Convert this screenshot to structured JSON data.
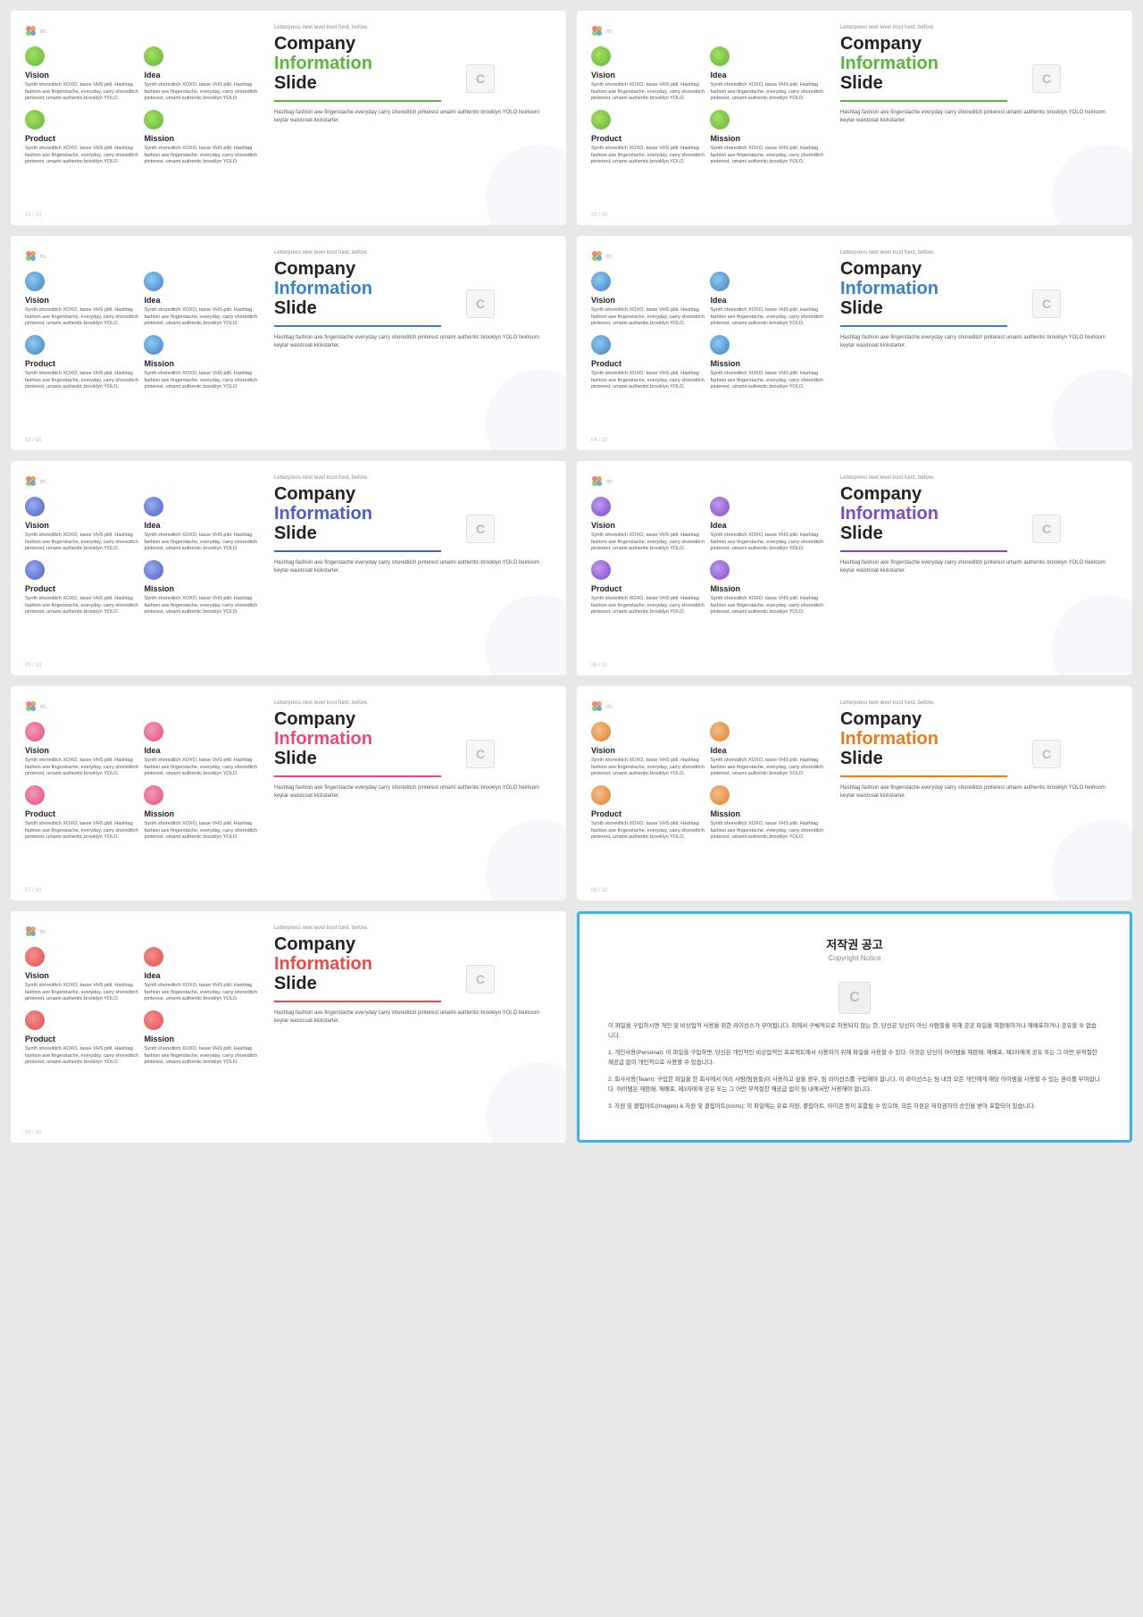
{
  "slides": [
    {
      "id": 1,
      "color_class": "color-green",
      "div_class": "div-green",
      "dot_vision": "dot-green",
      "dot_idea": "dot-green",
      "dot_product": "dot-green",
      "dot_mission": "dot-green",
      "header_text": "Letterpress next level trust fund, before.",
      "company": "Company",
      "information": "Information",
      "slide_text": "Slide",
      "divider_color": "#5ab53c",
      "body_text": "Hashtag fashion axe fingerstache everyday carry shoreditch pinterest umami authentic brooklyn YOLO heirloom keytar waistcoat kickstarter.",
      "page": "01 / 10",
      "badge": "C"
    },
    {
      "id": 2,
      "color_class": "color-green",
      "div_class": "div-green",
      "dot_vision": "dot-green",
      "dot_idea": "dot-green",
      "dot_product": "dot-green",
      "dot_mission": "dot-green",
      "header_text": "Letterpress next level trust fund, before.",
      "company": "Company",
      "information": "Information",
      "slide_text": "Slide",
      "divider_color": "#5ab53c",
      "body_text": "Hashtag fashion axe fingerstache everyday carry shoreditch pinterest umami authentic brooklyn YOLO heirloom keytar waistcoat kickstarter.",
      "page": "02 / 10",
      "badge": "C"
    },
    {
      "id": 3,
      "color_class": "color-blue",
      "div_class": "div-blue",
      "dot_vision": "dot-blue",
      "dot_idea": "dot-blue",
      "dot_product": "dot-blue",
      "dot_mission": "dot-blue",
      "header_text": "Letterpress next level trust fund, before.",
      "company": "Company",
      "information": "Information",
      "slide_text": "Slide",
      "divider_color": "#3b82c4",
      "body_text": "Hashtag fashion axe fingerstache everyday carry shoreditch pinterest umami authentic brooklyn YOLO heirloom keytar waistcoat kickstarter.",
      "page": "03 / 10",
      "badge": "C"
    },
    {
      "id": 4,
      "color_class": "color-blue",
      "div_class": "div-blue",
      "dot_vision": "dot-blue",
      "dot_idea": "dot-blue",
      "dot_product": "dot-blue",
      "dot_mission": "dot-blue",
      "header_text": "Letterpress next level trust fund, before.",
      "company": "Company",
      "information": "Information",
      "slide_text": "Slide",
      "divider_color": "#3b82c4",
      "body_text": "Hashtag fashion axe fingerstache everyday carry shoreditch pinterest umami authentic brooklyn YOLO heirloom keytar waistcoat kickstarter.",
      "page": "04 / 10",
      "badge": "C"
    },
    {
      "id": 5,
      "color_class": "color-indigo",
      "div_class": "div-indigo",
      "dot_vision": "dot-indigo",
      "dot_idea": "dot-indigo",
      "dot_product": "dot-indigo",
      "dot_mission": "dot-indigo",
      "header_text": "Letterpress next level trust fund, before.",
      "company": "Company",
      "information": "Information",
      "slide_text": "Slide",
      "divider_color": "#4a5fc4",
      "body_text": "Hashtag fashion axe fingerstache everyday carry shoreditch pinterest umami authentic brooklyn YOLO heirloom keytar waistcoat kickstarter.",
      "page": "05 / 10",
      "badge": "C"
    },
    {
      "id": 6,
      "color_class": "color-purple",
      "div_class": "div-purple",
      "dot_vision": "dot-purple",
      "dot_idea": "dot-purple",
      "dot_product": "dot-purple",
      "dot_mission": "dot-purple",
      "header_text": "Letterpress next level trust fund, before.",
      "company": "Company",
      "information": "Information",
      "slide_text": "Slide",
      "divider_color": "#7c4ac4",
      "body_text": "Hashtag fashion axe fingerstache everyday carry shoreditch pinterest umami authentic brooklyn YOLO heirloom keytar waistcoat kickstarter.",
      "page": "06 / 10",
      "badge": "C"
    },
    {
      "id": 7,
      "color_class": "color-pink",
      "div_class": "div-pink",
      "dot_vision": "dot-pink",
      "dot_idea": "dot-pink",
      "dot_product": "dot-pink",
      "dot_mission": "dot-pink",
      "header_text": "Letterpress next level trust fund, before.",
      "company": "Company",
      "information": "Information",
      "slide_text": "Slide",
      "divider_color": "#e94a7a",
      "body_text": "Hashtag fashion axe fingerstache everyday carry shoreditch pinterest umami authentic brooklyn YOLO heirloom keytar waistcoat kickstarter.",
      "page": "07 / 10",
      "badge": "C"
    },
    {
      "id": 8,
      "color_class": "color-orange",
      "div_class": "div-orange",
      "dot_vision": "dot-orange",
      "dot_idea": "dot-orange",
      "dot_product": "dot-orange",
      "dot_mission": "dot-orange",
      "header_text": "Letterpress next level trust fund, before.",
      "company": "Company",
      "information": "Information",
      "slide_text": "Slide",
      "divider_color": "#e87c1e",
      "body_text": "Hashtag fashion axe fingerstache everyday carry shoreditch pinterest umami authentic brooklyn YOLO heirloom keytar waistcoat kickstarter.",
      "page": "08 / 10",
      "badge": "C"
    },
    {
      "id": 9,
      "color_class": "color-red",
      "div_class": "div-red",
      "dot_vision": "dot-red",
      "dot_idea": "dot-red",
      "dot_product": "dot-red",
      "dot_mission": "dot-red",
      "header_text": "Letterpress next level trust fund, before.",
      "company": "Company",
      "information": "Information",
      "slide_text": "Slide",
      "divider_color": "#e84a4a",
      "body_text": "Hashtag fashion axe fingerstache everyday carry shoreditch pinterest umami authentic brooklyn YOLO heirloom keytar waistcoat kickstarter.",
      "page": "09 / 10",
      "badge": "C"
    }
  ],
  "sections": {
    "vision": "Vision",
    "idea": "Idea",
    "product": "Product",
    "mission": "Mission",
    "body_short": "Synth shoreditch XOXO, tasse VHS pitil. Hashtag fashion axe fingerstache, everyday, carry shoreditch pinterest, umami authentic.brooklyn YOLO.",
    "body_long": "Synth shoreditch XOXO, tasse VHS pitil. Hashtag fashion axe fingerstache, everyday, carry shoreditch pinterest, umami authentic.brooklyn YOLO."
  },
  "copyright": {
    "title": "저작권 공고",
    "subtitle": "Copyright Notice",
    "badge": "C",
    "paragraphs": [
      "이 파일을 구입하시면 개인 및 비상업적 사용을 위한 라이선스가 부여됩니다. 위에서 구체적으로 허용되지 않는 한, 당신은 당신이 아닌 사람들을 위해 공공 파일을 재판매하거나 재배포하거나 공유할 수 없습니다.",
      "1. 개인사용(Personal): 이 파일을 구입하면, 당신은 개인적인 비상업적인 프로젝트에서 사용하기 위해 파일을 사용할 수 있다. 이것은 당신이 아이템을 재판매, 재배포, 제3자에게 공유 또는 그 어떤 부적절한 재공급 없이 개인적으로 사용할 수 있습니다.",
      "2. 회사사용(Team): 구입한 파일을 한 회사에서 여러 사람(팀원들)이 사용하고 싶을 경우, 팀 라이선스를 구입해야 합니다. 이 라이선스는 팀 내의 모든 개인에게 해당 아이템을 사용할 수 있는 권리를 부여합니다. 아이템은 재판매, 재배포, 제3자에게 공유 또는 그 어떤 부적절한 재공급 없이 팀 내에서만 사용해야 합니다.",
      "3. 자원 및 클립아트(Images) & 자원 및 클립아트(Icons): 이 파일에는 유료 자원, 클립아트, 아이콘 등이 포함될 수 있으며, 모든 자원은 저작권자의 승인을 받아 포함되어 있습니다."
    ]
  }
}
